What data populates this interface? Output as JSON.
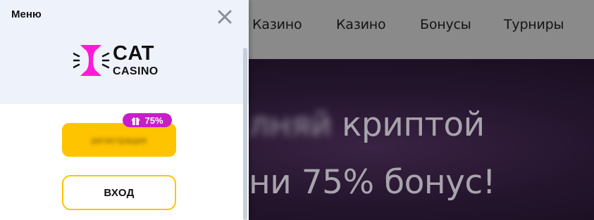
{
  "colors": {
    "accent_yellow": "#ffc400",
    "badge_magenta": "#c81ec8",
    "logo_magenta": "#ff1ad9",
    "drawer_top_bg": "#eef2fb",
    "header_overlay": "#8a8a8a"
  },
  "header": {
    "nav": [
      "Казино",
      "Казино",
      "Бонусы",
      "Турниры"
    ]
  },
  "hero": {
    "line1_blurred": "лняй",
    "line1": "криптой",
    "line2": "ни 75% бонус!"
  },
  "menu": {
    "title": "Меню",
    "close_icon": "close-icon",
    "logo": {
      "line1": "CAT",
      "line2": "CASINO"
    },
    "badge": {
      "icon": "gift-icon",
      "text": "75%"
    },
    "register_label": "регистрация",
    "login_label": "ВХОД"
  }
}
